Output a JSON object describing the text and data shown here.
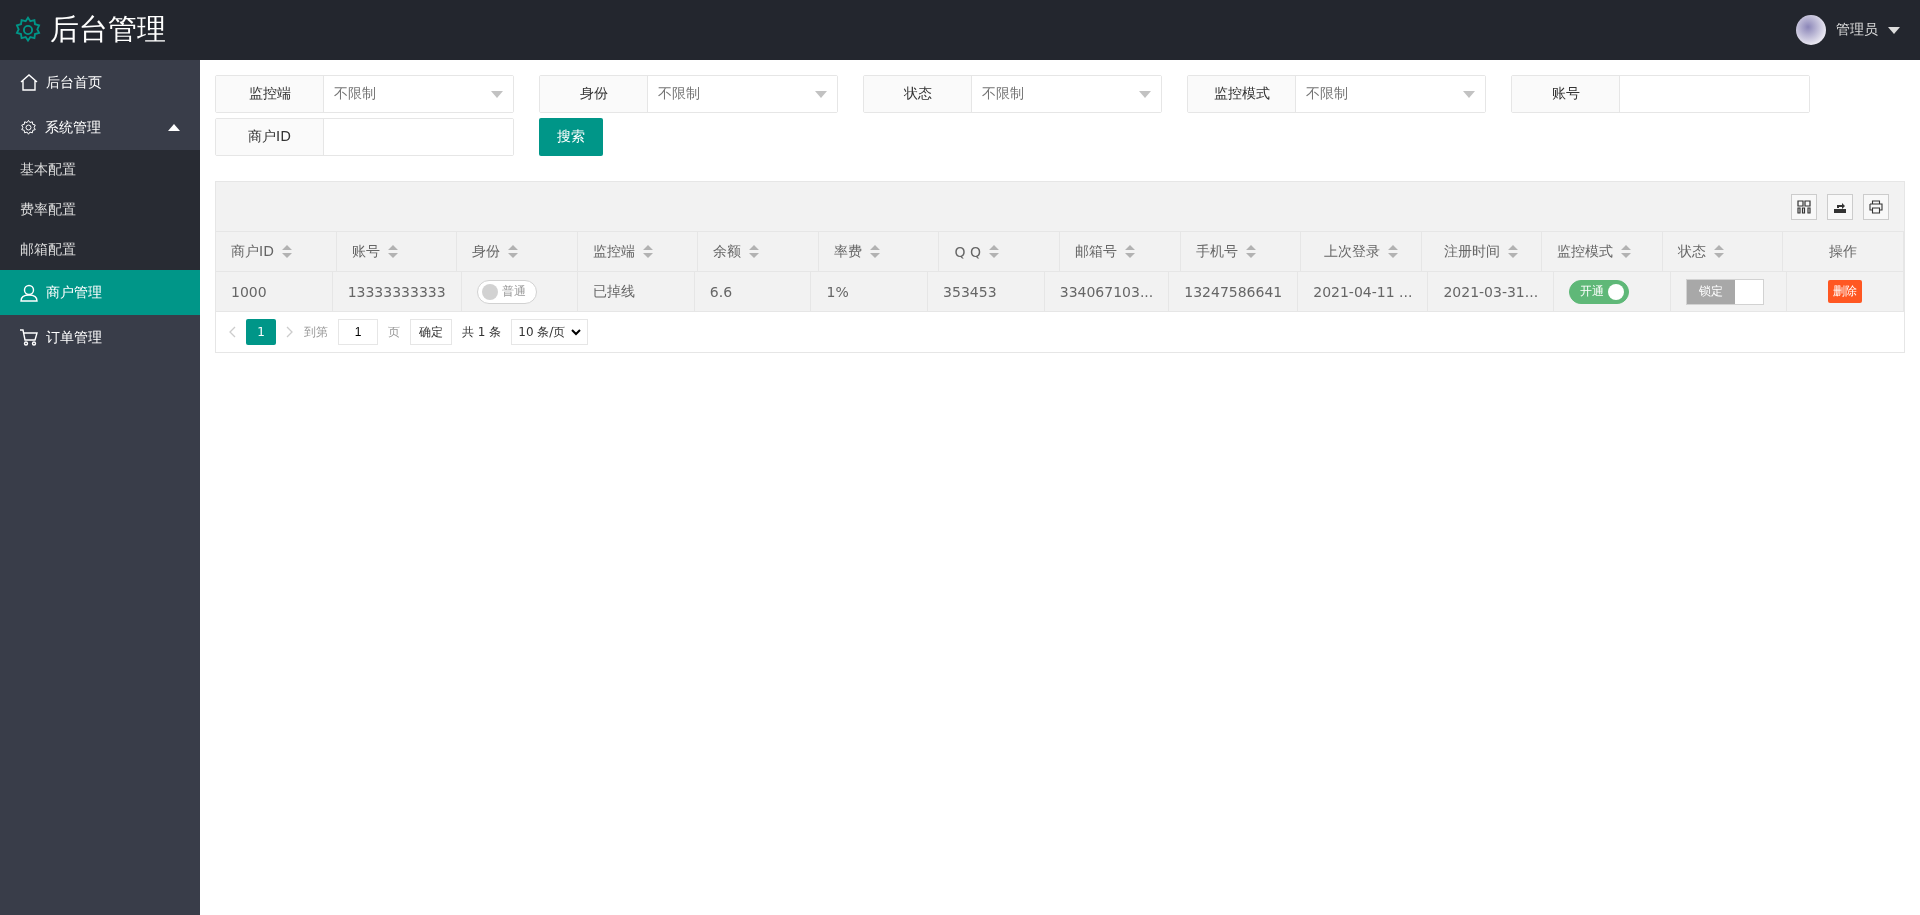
{
  "header": {
    "title": "后台管理",
    "user": "管理员"
  },
  "sidebar": {
    "items": [
      {
        "label": "后台首页",
        "selected": false
      },
      {
        "label": "系统管理",
        "selected": false,
        "expanded": true,
        "children": [
          {
            "label": "基本配置",
            "selected": false
          },
          {
            "label": "费率配置",
            "selected": false
          },
          {
            "label": "邮箱配置",
            "selected": false
          }
        ]
      },
      {
        "label": "商户管理",
        "selected": true
      },
      {
        "label": "订单管理",
        "selected": false
      }
    ]
  },
  "filters": [
    {
      "kind": "select",
      "label": "监控端",
      "value": "不限制"
    },
    {
      "kind": "select",
      "label": "身份",
      "value": "不限制"
    },
    {
      "kind": "select",
      "label": "状态",
      "value": "不限制"
    },
    {
      "kind": "select",
      "label": "监控模式",
      "value": "不限制"
    },
    {
      "kind": "input",
      "label": "账号"
    },
    {
      "kind": "input",
      "label": "商户ID"
    }
  ],
  "search_button": "搜索",
  "table": {
    "columns": [
      {
        "label": "商户ID",
        "sortable": true
      },
      {
        "label": "账号",
        "sortable": true
      },
      {
        "label": "身份",
        "sortable": true
      },
      {
        "label": "监控端",
        "sortable": true
      },
      {
        "label": "余额",
        "sortable": true
      },
      {
        "label": "率费",
        "sortable": true
      },
      {
        "label": "Q Q",
        "sortable": true
      },
      {
        "label": "邮箱号",
        "sortable": true
      },
      {
        "label": "手机号",
        "sortable": true
      },
      {
        "label": "上次登录",
        "sortable": true
      },
      {
        "label": "注册时间",
        "sortable": true
      },
      {
        "label": "监控模式",
        "sortable": true
      },
      {
        "label": "状态",
        "sortable": true
      },
      {
        "label": "操作",
        "sortable": false
      }
    ],
    "rows": [
      [
        {
          "kind": "text",
          "text": "1000"
        },
        {
          "kind": "text",
          "text": "13333333333"
        },
        {
          "kind": "switch",
          "text": "普通",
          "on": false
        },
        {
          "kind": "text",
          "text": "已掉线"
        },
        {
          "kind": "text",
          "text": "6.6"
        },
        {
          "kind": "text",
          "text": "1%"
        },
        {
          "kind": "text",
          "text": "353453"
        },
        {
          "kind": "text",
          "text": "334067103..."
        },
        {
          "kind": "text",
          "text": "13247586641"
        },
        {
          "kind": "text",
          "text": "2021-04-11 ..."
        },
        {
          "kind": "text",
          "text": "2021-03-31..."
        },
        {
          "kind": "switch",
          "text": "开通",
          "on": true
        },
        {
          "kind": "lock",
          "text": "锁定",
          "on": false
        },
        {
          "kind": "button",
          "text": "删除"
        }
      ]
    ]
  },
  "pagination": {
    "pages": [
      {
        "label": "1",
        "selected": true
      }
    ],
    "goto_label": "到第",
    "page_value": "1",
    "page_suffix": "页",
    "confirm": "确定",
    "total": "共 1 条",
    "page_size": "10 条/页"
  }
}
